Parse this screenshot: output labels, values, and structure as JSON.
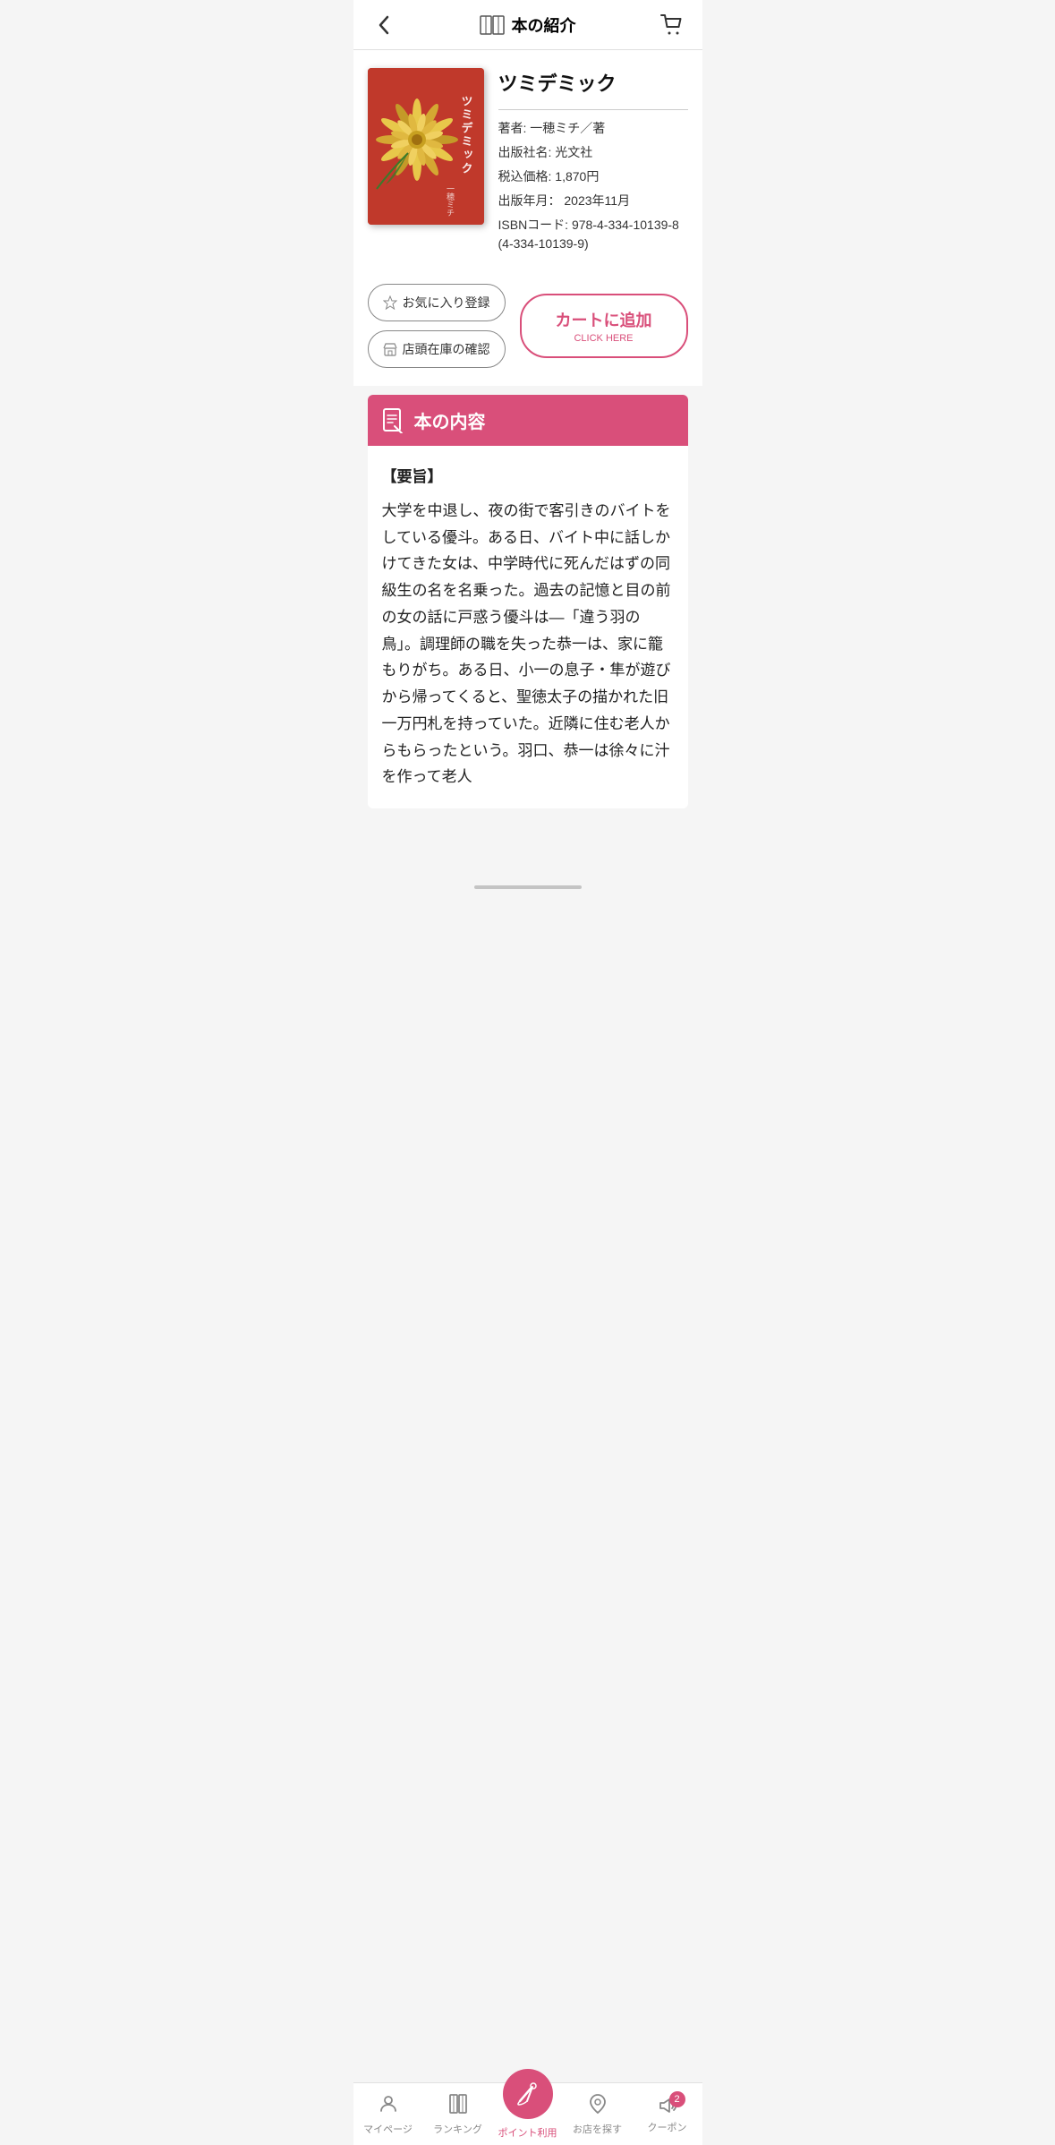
{
  "header": {
    "title": "本の紹介",
    "back_icon": "‹",
    "cart_icon": "🛒"
  },
  "book": {
    "title": "ツミデミック",
    "author_label": "著者:",
    "author_value": "一穂ミチ／著",
    "publisher_label": "出版社名:",
    "publisher_value": "光文社",
    "price_label": "税込価格:",
    "price_value": "1,870円",
    "pubdate_label": "出版年月：",
    "pubdate_value": "2023年11月",
    "isbn_label": "ISBNコード:",
    "isbn_value": "978-4-334-10139-8 (4-334-10139-9)",
    "cover_title_text": "ツミデミック",
    "cover_author_text": "一穂ミチ"
  },
  "actions": {
    "favorite_label": "お気に入り登録",
    "store_stock_label": "店頭在庫の確認",
    "add_to_cart_label": "カートに追加",
    "click_here_label": "CLICK HERE"
  },
  "content": {
    "section_title": "本の内容",
    "summary_heading": "【要旨】",
    "summary_text": "大学を中退し、夜の街で客引きのバイトをしている優斗。ある日、バイト中に話しかけてきた女は、中学時代に死んだはずの同級生の名を名乗った。過去の記憶と目の前の女の話に戸惑う優斗は―「違う羽の鳥」。調理師の職を失った恭一は、家に籠もりがち。ある日、小一の息子・隼が遊びから帰ってくると、聖徳太子の描かれた旧一万円札を持っていた。近隣に住む老人からもらったという。羽口、恭一は徐々に汁を作って老人"
  },
  "bottom_nav": {
    "items": [
      {
        "id": "mypage",
        "label": "マイページ",
        "icon": "person"
      },
      {
        "id": "ranking",
        "label": "ランキング",
        "icon": "book"
      },
      {
        "id": "point",
        "label": "ポイント利用",
        "icon": "broom",
        "center": true
      },
      {
        "id": "store",
        "label": "お店を探す",
        "icon": "location"
      },
      {
        "id": "coupon",
        "label": "クーポン",
        "icon": "volume",
        "badge": "2"
      }
    ]
  }
}
